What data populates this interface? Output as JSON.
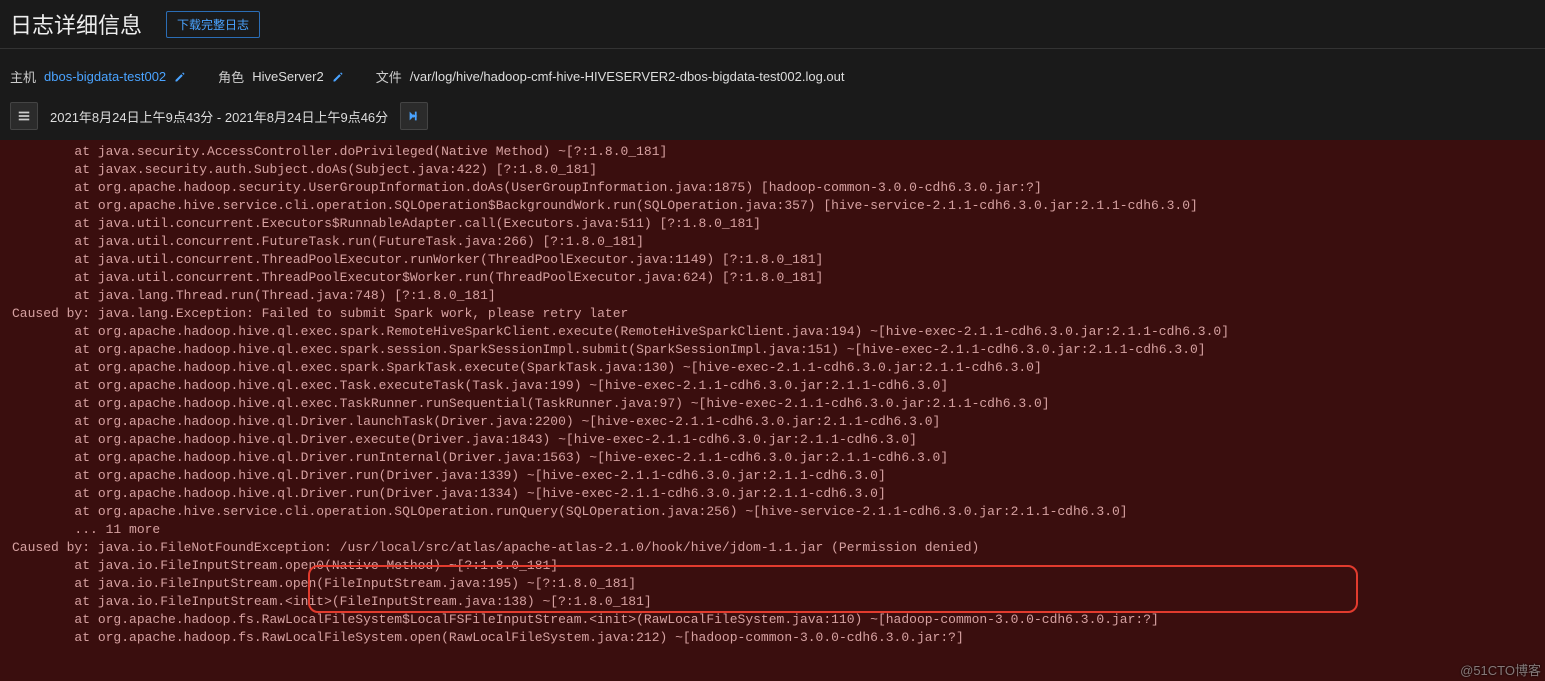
{
  "header": {
    "title": "日志详细信息",
    "download_label": "下载完整日志"
  },
  "meta": {
    "host_label": "主机",
    "host_value": "dbos-bigdata-test002",
    "role_label": "角色",
    "role_value": "HiveServer2",
    "file_label": "文件",
    "file_value": "/var/log/hive/hadoop-cmf-hive-HIVESERVER2-dbos-bigdata-test002.log.out"
  },
  "filter": {
    "date_range": "2021年8月24日上午9点43分 - 2021年8月24日上午9点46分"
  },
  "log": {
    "content": "        at java.security.AccessController.doPrivileged(Native Method) ~[?:1.8.0_181]\n        at javax.security.auth.Subject.doAs(Subject.java:422) [?:1.8.0_181]\n        at org.apache.hadoop.security.UserGroupInformation.doAs(UserGroupInformation.java:1875) [hadoop-common-3.0.0-cdh6.3.0.jar:?]\n        at org.apache.hive.service.cli.operation.SQLOperation$BackgroundWork.run(SQLOperation.java:357) [hive-service-2.1.1-cdh6.3.0.jar:2.1.1-cdh6.3.0]\n        at java.util.concurrent.Executors$RunnableAdapter.call(Executors.java:511) [?:1.8.0_181]\n        at java.util.concurrent.FutureTask.run(FutureTask.java:266) [?:1.8.0_181]\n        at java.util.concurrent.ThreadPoolExecutor.runWorker(ThreadPoolExecutor.java:1149) [?:1.8.0_181]\n        at java.util.concurrent.ThreadPoolExecutor$Worker.run(ThreadPoolExecutor.java:624) [?:1.8.0_181]\n        at java.lang.Thread.run(Thread.java:748) [?:1.8.0_181]\nCaused by: java.lang.Exception: Failed to submit Spark work, please retry later\n        at org.apache.hadoop.hive.ql.exec.spark.RemoteHiveSparkClient.execute(RemoteHiveSparkClient.java:194) ~[hive-exec-2.1.1-cdh6.3.0.jar:2.1.1-cdh6.3.0]\n        at org.apache.hadoop.hive.ql.exec.spark.session.SparkSessionImpl.submit(SparkSessionImpl.java:151) ~[hive-exec-2.1.1-cdh6.3.0.jar:2.1.1-cdh6.3.0]\n        at org.apache.hadoop.hive.ql.exec.spark.SparkTask.execute(SparkTask.java:130) ~[hive-exec-2.1.1-cdh6.3.0.jar:2.1.1-cdh6.3.0]\n        at org.apache.hadoop.hive.ql.exec.Task.executeTask(Task.java:199) ~[hive-exec-2.1.1-cdh6.3.0.jar:2.1.1-cdh6.3.0]\n        at org.apache.hadoop.hive.ql.exec.TaskRunner.runSequential(TaskRunner.java:97) ~[hive-exec-2.1.1-cdh6.3.0.jar:2.1.1-cdh6.3.0]\n        at org.apache.hadoop.hive.ql.Driver.launchTask(Driver.java:2200) ~[hive-exec-2.1.1-cdh6.3.0.jar:2.1.1-cdh6.3.0]\n        at org.apache.hadoop.hive.ql.Driver.execute(Driver.java:1843) ~[hive-exec-2.1.1-cdh6.3.0.jar:2.1.1-cdh6.3.0]\n        at org.apache.hadoop.hive.ql.Driver.runInternal(Driver.java:1563) ~[hive-exec-2.1.1-cdh6.3.0.jar:2.1.1-cdh6.3.0]\n        at org.apache.hadoop.hive.ql.Driver.run(Driver.java:1339) ~[hive-exec-2.1.1-cdh6.3.0.jar:2.1.1-cdh6.3.0]\n        at org.apache.hadoop.hive.ql.Driver.run(Driver.java:1334) ~[hive-exec-2.1.1-cdh6.3.0.jar:2.1.1-cdh6.3.0]\n        at org.apache.hive.service.cli.operation.SQLOperation.runQuery(SQLOperation.java:256) ~[hive-service-2.1.1-cdh6.3.0.jar:2.1.1-cdh6.3.0]\n        ... 11 more\nCaused by: java.io.FileNotFoundException: /usr/local/src/atlas/apache-atlas-2.1.0/hook/hive/jdom-1.1.jar (Permission denied)\n        at java.io.FileInputStream.open0(Native Method) ~[?:1.8.0_181]\n        at java.io.FileInputStream.open(FileInputStream.java:195) ~[?:1.8.0_181]\n        at java.io.FileInputStream.<init>(FileInputStream.java:138) ~[?:1.8.0_181]\n        at org.apache.hadoop.fs.RawLocalFileSystem$LocalFSFileInputStream.<init>(RawLocalFileSystem.java:110) ~[hadoop-common-3.0.0-cdh6.3.0.jar:?]\n        at org.apache.hadoop.fs.RawLocalFileSystem.open(RawLocalFileSystem.java:212) ~[hadoop-common-3.0.0-cdh6.3.0.jar:?]"
  },
  "watermark": "@51CTO博客"
}
